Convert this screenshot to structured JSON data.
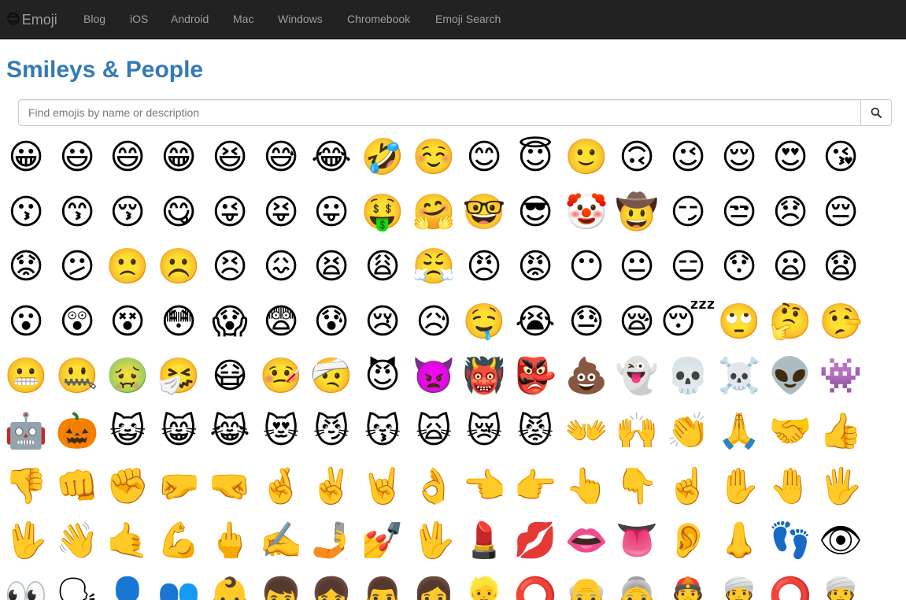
{
  "nav": {
    "brand_icon": "😊",
    "brand": "Emoji",
    "links": [
      "Blog",
      "iOS",
      "Android",
      "Mac",
      "Windows",
      "Chromebook",
      "Emoji Search"
    ]
  },
  "page": {
    "title": "Smileys & People"
  },
  "search": {
    "placeholder": "Find emojis by name or description",
    "value": "",
    "icon": "search-icon"
  },
  "emojis": [
    [
      "😀",
      "😃",
      "😄",
      "😁",
      "😆",
      "😅",
      "😂",
      "🤣",
      "☺️",
      "😊",
      "😇",
      "🙂",
      "🙃",
      "😉",
      "😌",
      "😍",
      "😘"
    ],
    [
      "😗",
      "😙",
      "😚",
      "😋",
      "😜",
      "😝",
      "😛",
      "🤑",
      "🤗",
      "🤓",
      "😎",
      "🤡",
      "🤠",
      "😏",
      "😒",
      "😞",
      "😔"
    ],
    [
      "😟",
      "😕",
      "🙁",
      "☹️",
      "😣",
      "😖",
      "😫",
      "😩",
      "😤",
      "😠",
      "😡",
      "😶",
      "😐",
      "😑",
      "😯",
      "😦",
      "😧"
    ],
    [
      "😮",
      "😲",
      "😵",
      "😳",
      "😱",
      "😨",
      "😰",
      "😢",
      "😥",
      "🤤",
      "😭",
      "😓",
      "😪",
      "😴",
      "🙄",
      "🤔",
      "🤥"
    ],
    [
      "😬",
      "🤐",
      "🤢",
      "🤧",
      "😷",
      "🤒",
      "🤕",
      "😈",
      "👿",
      "👹",
      "👺",
      "💩",
      "👻",
      "💀",
      "☠️",
      "👽",
      "👾"
    ],
    [
      "🤖",
      "🎃",
      "😺",
      "😸",
      "😹",
      "😻",
      "😼",
      "😽",
      "🙀",
      "😿",
      "😾",
      "👐",
      "🙌",
      "👏",
      "🙏",
      "🤝",
      "👍"
    ],
    [
      "👎",
      "👊",
      "✊",
      "🤛",
      "🤜",
      "🤞",
      "✌️",
      "🤘",
      "👌",
      "👈",
      "👉",
      "👆",
      "👇",
      "☝️",
      "✋",
      "🤚",
      "🖐"
    ],
    [
      "🖖",
      "👋",
      "🤙",
      "💪",
      "🖕",
      "✍️",
      "🤳",
      "💅",
      "🖖",
      "💄",
      "💋",
      "👄",
      "👅",
      "👂",
      "👃",
      "👣",
      "👁"
    ],
    [
      "👀",
      "🗣",
      "👤",
      "👥",
      "👶",
      "👦",
      "👧",
      "👨",
      "👩",
      "👱",
      "⭕",
      "👴",
      "👵",
      "👲",
      "👳",
      "⭕",
      "👳"
    ]
  ]
}
